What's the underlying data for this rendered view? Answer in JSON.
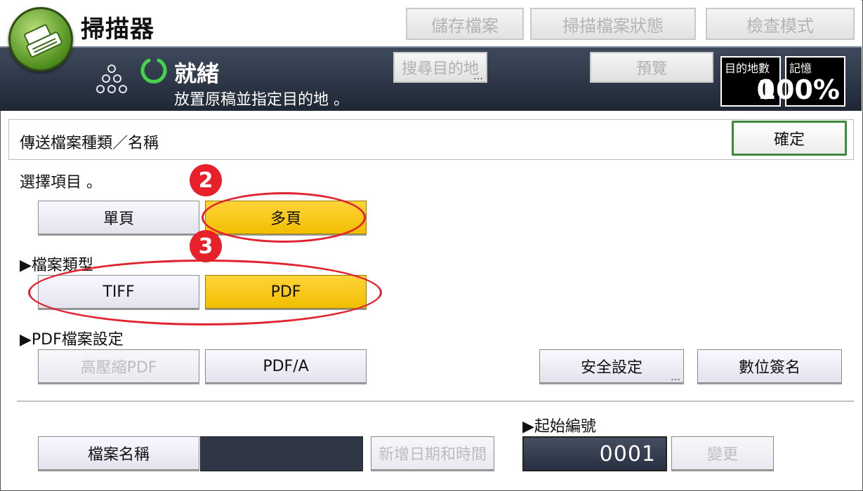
{
  "app": {
    "title": "掃描器"
  },
  "top_buttons": {
    "store": "儲存檔案",
    "status": "掃描檔案狀態",
    "check": "檢查模式"
  },
  "status": {
    "title": "就緒",
    "message": "放置原稿並指定目的地 。",
    "search_dest": "搜尋目的地",
    "preview": "預覽"
  },
  "counters": {
    "dest_label": "目的地數",
    "dest_value": "0",
    "memory_label": "記憶",
    "memory_value": "100%"
  },
  "panel": {
    "title": "傳送檔案種類／名稱",
    "ok": "確定",
    "select_prompt": "選擇項目 。",
    "page_options": {
      "single": "單頁",
      "multi": "多頁",
      "selected": "多頁"
    },
    "file_type": {
      "label": "▶檔案類型",
      "tiff": "TIFF",
      "pdf": "PDF",
      "selected": "PDF"
    },
    "pdf_settings": {
      "label": "▶PDF檔案設定",
      "high_comp": "高壓縮PDF",
      "pdfa": "PDF/A",
      "security": "安全設定",
      "digital_sig": "數位簽名"
    },
    "file_name": {
      "button": "檔案名稱",
      "value": "",
      "add_date": "新增日期和時間"
    },
    "start_number": {
      "label": "▶起始編號",
      "value": "0001",
      "change": "變更"
    }
  },
  "annotations": {
    "step2": "2",
    "step3": "3"
  },
  "colors": {
    "selected": "#f2be00",
    "annotation": "#e0232e",
    "status_bg": "#2a3344",
    "ok_border": "#3d8a3d"
  }
}
